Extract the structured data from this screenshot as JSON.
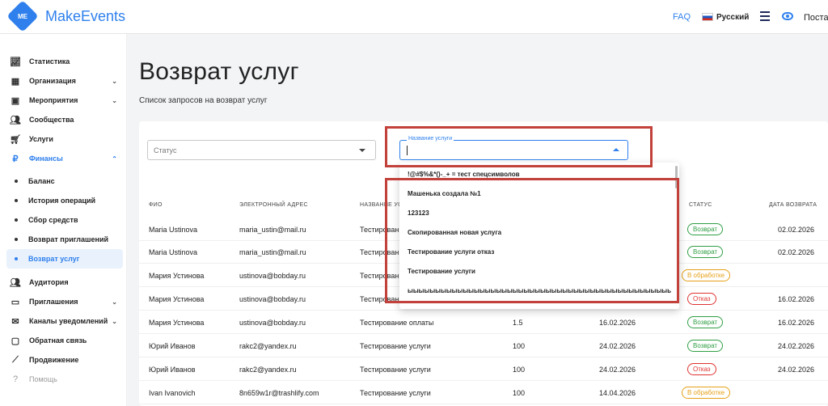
{
  "app": {
    "logo_text": "ME",
    "name": "MakeEvents"
  },
  "topbar": {
    "faq": "FAQ",
    "language": "Русский",
    "provider": "Постав"
  },
  "sidebar": {
    "items": [
      {
        "label": "Статистика",
        "icon": "chart-icon"
      },
      {
        "label": "Организация",
        "icon": "building-icon",
        "chevron": "down"
      },
      {
        "label": "Мероприятия",
        "icon": "calendar-icon",
        "chevron": "down"
      },
      {
        "label": "Сообщества",
        "icon": "people-icon"
      },
      {
        "label": "Услуги",
        "icon": "cart-icon"
      },
      {
        "label": "Финансы",
        "icon": "ruble-icon",
        "chevron": "up"
      }
    ],
    "finance_sub": [
      "Баланс",
      "История операций",
      "Сбор средств",
      "Возврат приглашений",
      "Возврат услуг"
    ],
    "bottom": [
      {
        "label": "Аудитория",
        "icon": "audience-icon"
      },
      {
        "label": "Приглашения",
        "icon": "ticket-icon",
        "chevron": "down"
      },
      {
        "label": "Каналы уведомлений",
        "icon": "mail-icon",
        "chevron": "down"
      },
      {
        "label": "Обратная связь",
        "icon": "feedback-icon"
      },
      {
        "label": "Продвижение",
        "icon": "trend-icon"
      },
      {
        "label": "Помощь",
        "icon": "help-icon"
      }
    ]
  },
  "page": {
    "title": "Возврат услуг",
    "subtitle": "Список запросов на возврат услуг"
  },
  "filters": {
    "status_placeholder": "Статус",
    "service_label": "Название услуги"
  },
  "table": {
    "headers": [
      "ФИО",
      "ЭЛЕКТРОННЫЙ АДРЕС",
      "НАЗВАНИЕ УСЛ",
      "СТАТУС",
      "ДАТА ВОЗВРАТА"
    ],
    "rows": [
      {
        "name": "Maria Ustinova",
        "email": "maria_ustin@mail.ru",
        "service": "Тестирование",
        "amount": "",
        "date": "",
        "status": "Возврат",
        "status_type": "ret",
        "return_date": "02.02.2026"
      },
      {
        "name": "Maria Ustinova",
        "email": "maria_ustin@mail.ru",
        "service": "Тестирование",
        "amount": "",
        "date": "",
        "status": "Возврат",
        "status_type": "ret",
        "return_date": "02.02.2026"
      },
      {
        "name": "Мария Устинова",
        "email": "ustinova@bobday.ru",
        "service": "Тестирование",
        "amount": "",
        "date": "",
        "status": "В обработке",
        "status_type": "proc",
        "return_date": ""
      },
      {
        "name": "Мария Устинова",
        "email": "ustinova@bobday.ru",
        "service": "Тестирование",
        "amount": "",
        "date": "",
        "status": "Отказ",
        "status_type": "ref",
        "return_date": "16.02.2026"
      },
      {
        "name": "Мария Устинова",
        "email": "ustinova@bobday.ru",
        "service": "Тестирование оплаты",
        "amount": "1.5",
        "date": "16.02.2026",
        "status": "Возврат",
        "status_type": "ret",
        "return_date": "16.02.2026"
      },
      {
        "name": "Юрий Иванов",
        "email": "rakc2@yandex.ru",
        "service": "Тестирование услуги",
        "amount": "100",
        "date": "24.02.2026",
        "status": "Возврат",
        "status_type": "ret",
        "return_date": "24.02.2026"
      },
      {
        "name": "Юрий Иванов",
        "email": "rakc2@yandex.ru",
        "service": "Тестирование услуги",
        "amount": "100",
        "date": "24.02.2026",
        "status": "Отказ",
        "status_type": "ref",
        "return_date": "24.02.2026"
      },
      {
        "name": "Ivan Ivanovich",
        "email": "8n659w1r@trashlify.com",
        "service": "Тестирование услуги",
        "amount": "100",
        "date": "14.04.2026",
        "status": "В обработке",
        "status_type": "proc",
        "return_date": ""
      }
    ]
  },
  "dropdown": {
    "options": [
      "!@#$%&*()-_+ = тест спецсимволов",
      "Машенька создала №1",
      "123123",
      "Скопированная новая услуга",
      "Тестирование услуги отказ",
      "Тестирование услуги",
      "ыыыыыыыыыыыыыыыыыыыыыыыыыыыыыыыыыыыыыыыыыыыыыыыыыыыыыыыы"
    ]
  },
  "colors": {
    "accent": "#2f80ed",
    "highlight": "#c2413b",
    "return": "#2f9e44",
    "processing": "#e6a017",
    "refused": "#e03131"
  }
}
